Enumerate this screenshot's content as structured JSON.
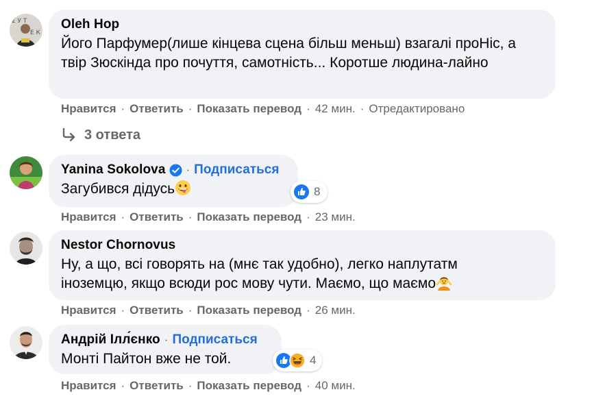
{
  "comments": [
    {
      "author": "Oleh Hop",
      "verified": false,
      "follow_label": "",
      "text": "Його Парфумер(лише кінцева сцена більш меньш) взагалі проНіс, а твір Зюскінда про почуття, самотність... Коротше людина-лайно",
      "actions": {
        "like": "Нравится",
        "reply": "Ответить",
        "translate": "Показать перевод",
        "time": "42 мин.",
        "edited": "Отредактировано"
      },
      "replies_label": "3 ответа"
    },
    {
      "author": "Yanina Sokolova",
      "verified": true,
      "follow_label": "Подписаться",
      "text": "Загубився дідусь",
      "text_emoji": "grinning-face-with-tongue",
      "reactions": {
        "icons": [
          "like"
        ],
        "count": "8"
      },
      "actions": {
        "like": "Нравится",
        "reply": "Ответить",
        "translate": "Показать перевод",
        "time": "23 мин."
      }
    },
    {
      "author": "Nestor Chornovus",
      "verified": false,
      "follow_label": "",
      "text_line1": "Ну, а що, всі говорять на (мнє так удобно), легко наплутатм",
      "text_line2": "іноземцю, якщо всюди рос мову чути. Маємо, що маємо",
      "text_emoji": "person-shrugging",
      "actions": {
        "like": "Нравится",
        "reply": "Ответить",
        "translate": "Показать перевод",
        "time": "26 мин."
      }
    },
    {
      "author": "Андрій Ілл́єнко",
      "verified": false,
      "follow_label": "Подписаться",
      "text": "Монті Пайтон вже не той.",
      "reactions": {
        "icons": [
          "like",
          "haha"
        ],
        "count": "4"
      },
      "actions": {
        "like": "Нравится",
        "reply": "Ответить",
        "translate": "Показать перевод",
        "time": "40 мин."
      }
    }
  ],
  "colors": {
    "bubble": "#f0f2f5",
    "meta": "#65676b",
    "link": "#216fdb",
    "like_blue": "#1877f2",
    "haha_yellow": "#f7b125"
  }
}
